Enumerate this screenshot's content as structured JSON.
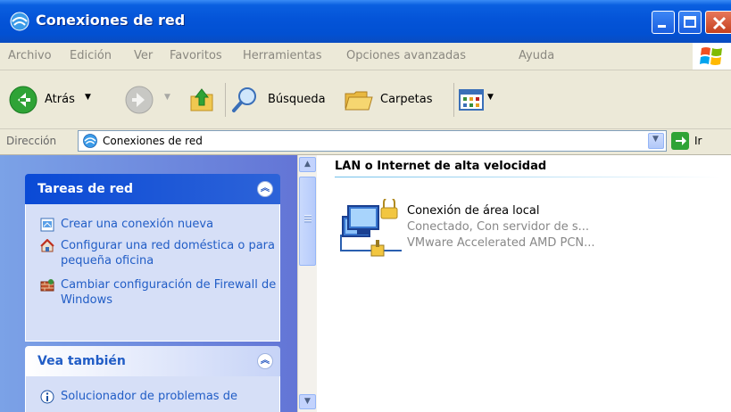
{
  "window": {
    "title": "Conexiones de red"
  },
  "menu": [
    "Archivo",
    "Edición",
    "Ver",
    "Favoritos",
    "Herramientas",
    "Opciones avanzadas",
    "Ayuda"
  ],
  "toolbar": {
    "back_label": "Atrás",
    "search_label": "Búsqueda",
    "folders_label": "Carpetas"
  },
  "address": {
    "label": "Dirección",
    "value": "Conexiones de red",
    "go_label": "Ir"
  },
  "sidebar": {
    "network_tasks": {
      "title": "Tareas de red",
      "items": [
        {
          "label": "Crear una conexión nueva",
          "icon": "new-connection-icon"
        },
        {
          "label": "Configurar una red doméstica o para pequeña oficina",
          "icon": "home-network-icon"
        },
        {
          "label": "Cambiar configuración de Firewall de Windows",
          "icon": "firewall-icon"
        }
      ]
    },
    "see_also": {
      "title": "Vea también",
      "items": [
        {
          "label": "Solucionador de problemas de",
          "icon": "info-icon"
        }
      ]
    }
  },
  "content": {
    "group_title": "LAN o Internet de alta velocidad",
    "connection": {
      "name": "Conexión de área local",
      "status": "Conectado, Con servidor de s...",
      "device": "VMware Accelerated AMD PCN..."
    }
  },
  "colors": {
    "title_bar": "#0454d8",
    "link": "#215dc6",
    "sidebar": "#7ba2e7",
    "panel_header": "#0a4ad6"
  }
}
